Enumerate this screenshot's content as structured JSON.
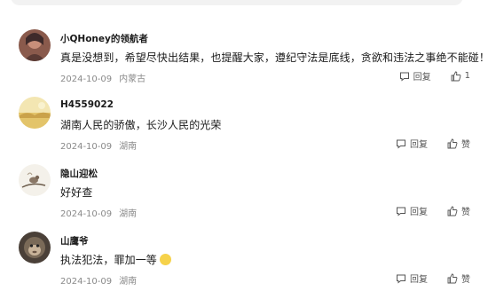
{
  "comments": [
    {
      "username": "小QHoney的领航者",
      "content": "真是没想到，希望尽快出结果，也提醒大家，遵纪守法是底线，贪欲和违法之事绝不能碰！",
      "date": "2024-10-09",
      "location": "内蒙古",
      "reply_label": "回复",
      "like_label": "1",
      "avatar_icon": "person-photo-avatar"
    },
    {
      "username": "H4559022",
      "content": "湖南人民的骄傲，长沙人民的光荣",
      "date": "2024-10-09",
      "location": "湖南",
      "reply_label": "回复",
      "like_label": "赞",
      "avatar_icon": "landscape-avatar"
    },
    {
      "username": "隐山迎松",
      "content": "好好查",
      "date": "2024-10-09",
      "location": "湖南",
      "reply_label": "回复",
      "like_label": "赞",
      "avatar_icon": "bird-branch-avatar"
    },
    {
      "username": "山鹰爷",
      "content": "执法犯法，罪加一等",
      "date": "2024-10-09",
      "location": "湖南",
      "reply_label": "回复",
      "like_label": "赞",
      "avatar_icon": "monkey-avatar",
      "emoji_icon": "grin-emoji-icon"
    }
  ]
}
